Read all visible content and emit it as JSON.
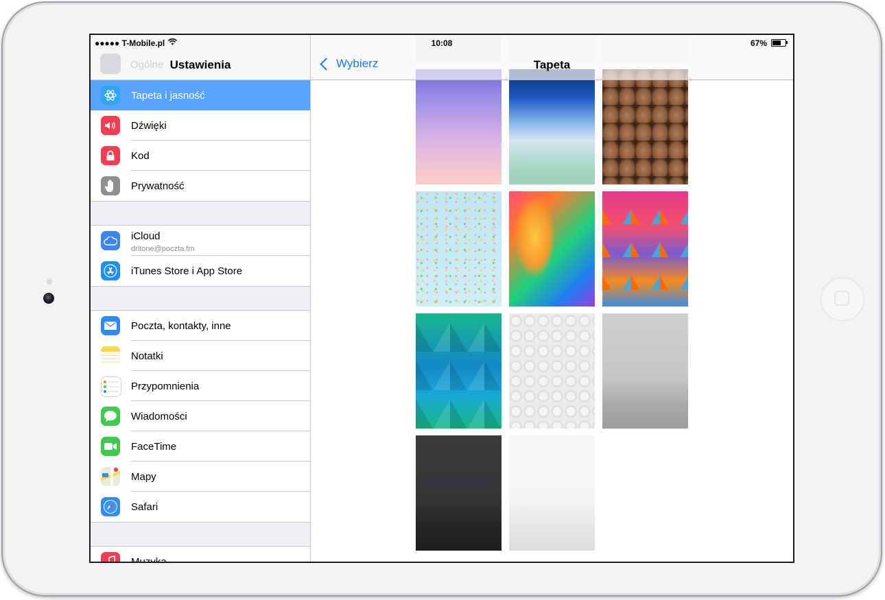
{
  "status_bar": {
    "carrier": "●●●●● T-Mobile.pl",
    "time": "10:08",
    "battery": "67%",
    "battery_level": 0.67
  },
  "left_pane": {
    "title": "Ustawienia",
    "hidden_item": "Ogólne",
    "items": [
      {
        "label": "Tapeta i jasność",
        "icon": "wallpaper-icon",
        "color": "#2ea7f0",
        "selected": true
      },
      {
        "label": "Dźwięki",
        "icon": "speaker-icon",
        "color": "#f43d53"
      },
      {
        "label": "Kod",
        "icon": "lock-icon",
        "color": "#f43d53"
      },
      {
        "label": "Prywatność",
        "icon": "hand-icon",
        "color": "#8e8e93"
      },
      {
        "label": "iCloud",
        "sublabel": "dritone@poczta.fm",
        "icon": "cloud-icon",
        "color": "#3b86f0"
      },
      {
        "label": "iTunes Store i App Store",
        "icon": "app-store-icon",
        "color": "#1f8ff7"
      },
      {
        "label": "Poczta, kontakty, inne",
        "icon": "mail-icon",
        "color": "#2b8af5"
      },
      {
        "label": "Notatki",
        "icon": "notes-icon",
        "color": "#f7d84a"
      },
      {
        "label": "Przypomnienia",
        "icon": "reminders-icon",
        "color": "#ffffff"
      },
      {
        "label": "Wiadomości",
        "icon": "messages-icon",
        "color": "#3ecb4c"
      },
      {
        "label": "FaceTime",
        "icon": "facetime-icon",
        "color": "#3ecb4c"
      },
      {
        "label": "Mapy",
        "icon": "maps-icon",
        "color": "#e5e8d8"
      },
      {
        "label": "Safari",
        "icon": "safari-icon",
        "color": "#2f8ef5"
      },
      {
        "label": "Muzyka",
        "icon": "music-icon",
        "color": "#f43d53"
      }
    ]
  },
  "right_pane": {
    "back_label": "Wybierz",
    "title": "Tapeta"
  },
  "colors": {
    "accent": "#1a7cf5",
    "selected_row": "#56a4fd"
  }
}
